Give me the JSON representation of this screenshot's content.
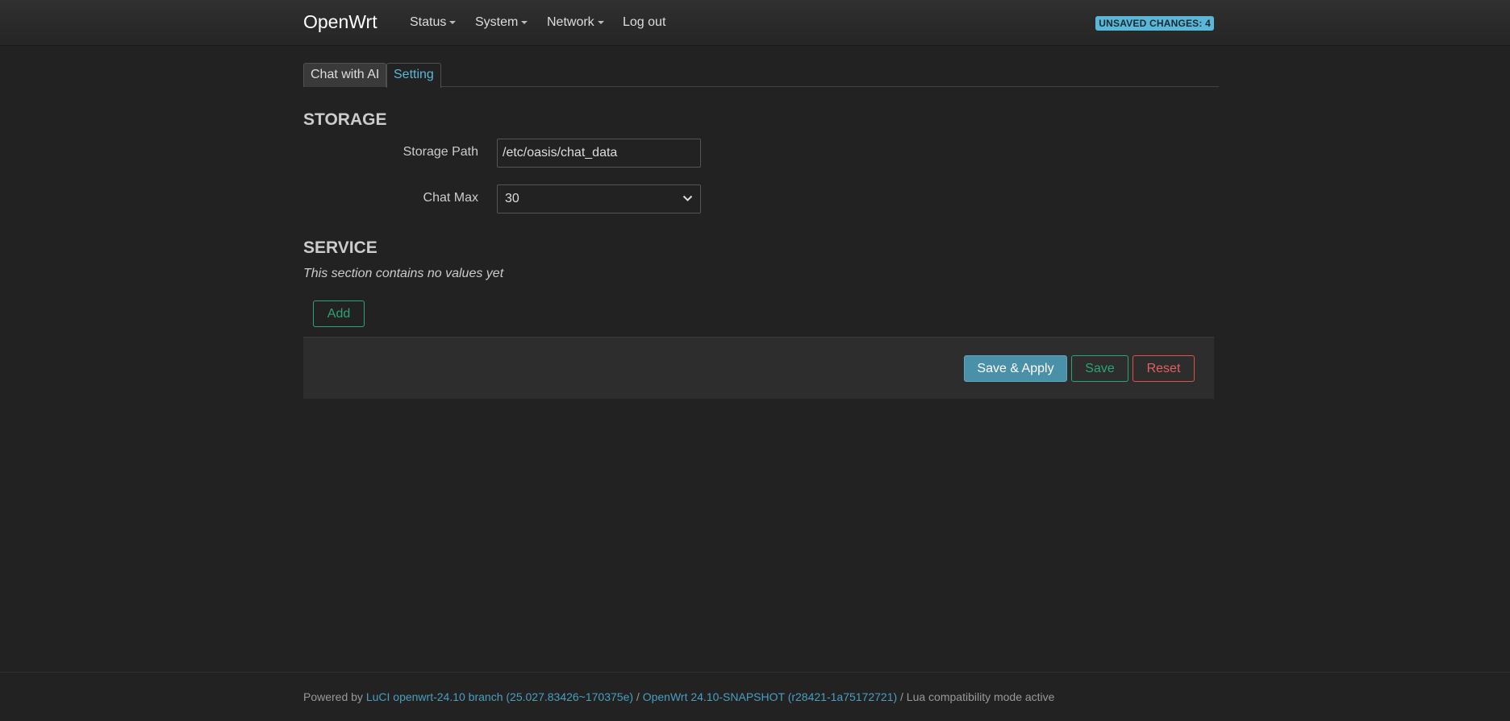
{
  "header": {
    "brand": "OpenWrt",
    "menu": [
      {
        "label": "Status"
      },
      {
        "label": "System"
      },
      {
        "label": "Network"
      }
    ],
    "logout": "Log out",
    "unsaved_badge": "UNSAVED CHANGES: 4"
  },
  "tabs": [
    {
      "label": "Chat with AI",
      "active": false
    },
    {
      "label": "Setting",
      "active": true
    }
  ],
  "storage": {
    "title": "STORAGE",
    "path_label": "Storage Path",
    "path_value": "/etc/oasis/chat_data",
    "chat_max_label": "Chat Max",
    "chat_max_value": "30"
  },
  "service": {
    "title": "SERVICE",
    "empty_note": "This section contains no values yet",
    "add_label": "Add"
  },
  "actions": {
    "save_apply": "Save & Apply",
    "save": "Save",
    "reset": "Reset"
  },
  "footer": {
    "prefix": "Powered by ",
    "luci_link": "LuCI openwrt-24.10 branch (25.027.83426~170375e)",
    "sep1": " / ",
    "openwrt_link": "OpenWrt 24.10-SNAPSHOT (r28421-1a75172721)",
    "suffix": " / Lua compatibility mode active"
  },
  "colors": {
    "accent": "#5bb7d8",
    "success": "#2fa374",
    "danger": "#d9534f",
    "background": "#222222"
  }
}
